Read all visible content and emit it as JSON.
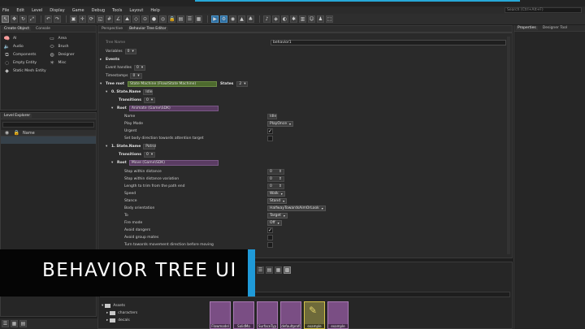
{
  "menubar": {
    "items": [
      "File",
      "Edit",
      "Level",
      "Display",
      "Game",
      "Debug",
      "Tools",
      "Layout",
      "Help"
    ],
    "search_placeholder": "Search (Ctrl+Alt+F)"
  },
  "left_top": {
    "tabs": [
      "Create Object",
      "Console"
    ],
    "items": [
      {
        "label": "AI",
        "icon": "ai-icon"
      },
      {
        "label": "Area",
        "icon": "area-icon"
      },
      {
        "label": "Audio",
        "icon": "audio-icon"
      },
      {
        "label": "Brush",
        "icon": "brush-icon"
      },
      {
        "label": "Components",
        "icon": "components-icon"
      },
      {
        "label": "Designer",
        "icon": "designer-icon"
      },
      {
        "label": "Empty Entity",
        "icon": "entity-icon"
      },
      {
        "label": "Misc",
        "icon": "misc-icon"
      },
      {
        "label": "Static Mesh Entity",
        "icon": "static-mesh-icon"
      }
    ]
  },
  "level_explorer": {
    "title": "Level Explorer",
    "column_name": "Name"
  },
  "editor": {
    "tabs": [
      "Perspective",
      "Behavior Tree Editor"
    ],
    "tree_name_label": "Tree Name",
    "tree_name_value": "behavior1",
    "variables_label": "Variables",
    "variables_count": "0",
    "events_label": "Events",
    "event_handles_label": "Event handles",
    "event_handles_count": "0",
    "timestamps_label": "Timestamps",
    "timestamps_count": "0",
    "tree_root_label": "Tree root",
    "tree_root_value": "State Machine (Flow\\State Machine)",
    "states_label": "States",
    "states_count": "2",
    "state0": {
      "prefix": "0. State.Name",
      "name": "Idle",
      "transitions_label": "Transitions",
      "transitions_count": "0",
      "root_label": "Root",
      "root_value": "Animate (Game\\SDK)",
      "props": [
        {
          "label": "Name",
          "value": "Idle"
        },
        {
          "label": "Play Mode",
          "value": "PlayOnce"
        },
        {
          "label": "Urgent",
          "checked": true
        },
        {
          "label": "Set body direction towards attention target",
          "checked": false
        }
      ]
    },
    "state1": {
      "prefix": "1. State.Name",
      "name": "Patrol",
      "transitions_label": "Transitions",
      "transitions_count": "0",
      "root_label": "Root",
      "root_value": "Move (Game\\SDK)",
      "props": [
        {
          "label": "Stop within distance",
          "value": "0"
        },
        {
          "label": "Stop within distance variation",
          "value": "0"
        },
        {
          "label": "Length to trim from the path end",
          "value": "0"
        },
        {
          "label": "Speed",
          "value": "Walk"
        },
        {
          "label": "Stance",
          "value": "Stand"
        },
        {
          "label": "Body orientation",
          "value": "HalfwayTowardsAimOrLook"
        },
        {
          "label": "To",
          "value": "Target"
        },
        {
          "label": "Fire mode",
          "value": "Off"
        },
        {
          "label": "Avoid dangers",
          "checked": true
        },
        {
          "label": "Avoid group mates",
          "checked": false
        },
        {
          "label": "Turn towards movement direction before moving",
          "checked": false
        }
      ]
    }
  },
  "right_panel": {
    "tabs": [
      "Properties",
      "Designer Tool"
    ]
  },
  "asset_browser": {
    "root_label": "Assets",
    "folders": [
      "characters",
      "decals"
    ],
    "assets": [
      {
        "label": "Flowmodel",
        "selected": false
      },
      {
        "label": "SolidMo",
        "selected": false
      },
      {
        "label": "SurfaceTyp",
        "selected": false
      },
      {
        "label": "defaultprofi",
        "selected": false
      },
      {
        "label": "example",
        "selected": true
      },
      {
        "label": "example",
        "selected": false
      }
    ]
  },
  "banner": {
    "title": "BEHAVIOR TREE UI"
  }
}
